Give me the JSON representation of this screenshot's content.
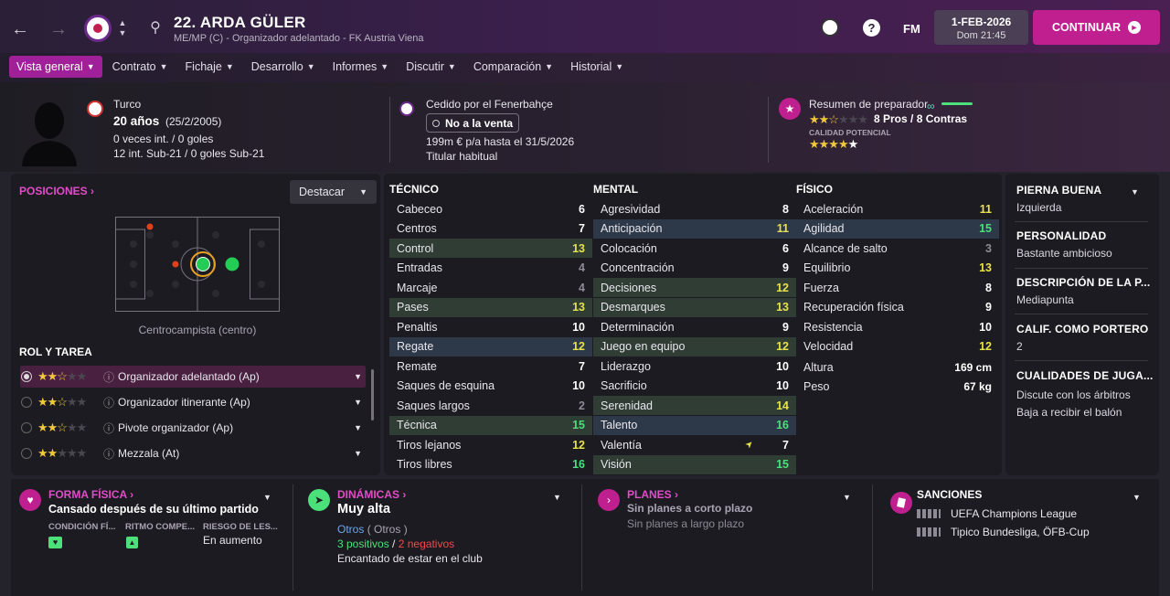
{
  "header": {
    "player_title": "22. ARDA GÜLER",
    "player_subtitle": "ME/MP (C) - Organizador adelantado - FK Austria Viena",
    "date": "1-FEB-2026",
    "day_time": "Dom 21:45",
    "continue_label": "CONTINUAR",
    "fm_label": "FM"
  },
  "nav": {
    "tabs": [
      {
        "label": "Vista general"
      },
      {
        "label": "Contrato"
      },
      {
        "label": "Fichaje"
      },
      {
        "label": "Desarrollo"
      },
      {
        "label": "Informes"
      },
      {
        "label": "Discutir"
      },
      {
        "label": "Comparación"
      },
      {
        "label": "Historial"
      }
    ]
  },
  "profile": {
    "nationality": "Turco",
    "age": "20 años",
    "birth": "(25/2/2005)",
    "caps": "0 veces int. / 0 goles",
    "u21": "12 int. Sub-21 / 0 goles Sub-21",
    "loan": "Cedido por el Fenerbahçe",
    "transfer_status": "No a la venta",
    "wage": "199m € p/a hasta el 31/5/2026",
    "squad_status": "Titular habitual",
    "coach_summary": "Resumen de preparador",
    "pros_cons": "8 Pros / 8 Contras",
    "potential_label": "CALIDAD POTENCIAL",
    "current_stars": "2.5",
    "potential_stars": "4.5"
  },
  "positions": {
    "title": "POSICIONES",
    "highlight": "Destacar",
    "position_name": "Centrocampista (centro)",
    "role_title": "ROL Y TAREA",
    "roles": [
      {
        "name": "Organizador adelantado (Ap)",
        "stars": "2.5"
      },
      {
        "name": "Organizador itinerante (Ap)",
        "stars": "2.5"
      },
      {
        "name": "Pivote organizador (Ap)",
        "stars": "2.5"
      },
      {
        "name": "Mezzala (At)",
        "stars": "2"
      }
    ]
  },
  "attributes": {
    "tecnico_title": "TÉCNICO",
    "mental_title": "MENTAL",
    "fisico_title": "FÍSICO",
    "tecnico": [
      {
        "name": "Cabeceo",
        "value": "6"
      },
      {
        "name": "Centros",
        "value": "7"
      },
      {
        "name": "Control",
        "value": "13"
      },
      {
        "name": "Entradas",
        "value": "4"
      },
      {
        "name": "Marcaje",
        "value": "4"
      },
      {
        "name": "Pases",
        "value": "13"
      },
      {
        "name": "Penaltis",
        "value": "10"
      },
      {
        "name": "Regate",
        "value": "12"
      },
      {
        "name": "Remate",
        "value": "7"
      },
      {
        "name": "Saques de esquina",
        "value": "10"
      },
      {
        "name": "Saques largos",
        "value": "2"
      },
      {
        "name": "Técnica",
        "value": "15"
      },
      {
        "name": "Tiros lejanos",
        "value": "12"
      },
      {
        "name": "Tiros libres",
        "value": "16"
      }
    ],
    "mental": [
      {
        "name": "Agresividad",
        "value": "8"
      },
      {
        "name": "Anticipación",
        "value": "11"
      },
      {
        "name": "Colocación",
        "value": "6"
      },
      {
        "name": "Concentración",
        "value": "9"
      },
      {
        "name": "Decisiones",
        "value": "12"
      },
      {
        "name": "Desmarques",
        "value": "13"
      },
      {
        "name": "Determinación",
        "value": "9"
      },
      {
        "name": "Juego en equipo",
        "value": "12"
      },
      {
        "name": "Liderazgo",
        "value": "10"
      },
      {
        "name": "Sacrificio",
        "value": "10"
      },
      {
        "name": "Serenidad",
        "value": "14"
      },
      {
        "name": "Talento",
        "value": "16"
      },
      {
        "name": "Valentía",
        "value": "7"
      },
      {
        "name": "Visión",
        "value": "15"
      }
    ],
    "fisico": [
      {
        "name": "Aceleración",
        "value": "11"
      },
      {
        "name": "Agilidad",
        "value": "15"
      },
      {
        "name": "Alcance de salto",
        "value": "3"
      },
      {
        "name": "Equilibrio",
        "value": "13"
      },
      {
        "name": "Fuerza",
        "value": "8"
      },
      {
        "name": "Recuperación física",
        "value": "9"
      },
      {
        "name": "Resistencia",
        "value": "10"
      },
      {
        "name": "Velocidad",
        "value": "12"
      }
    ],
    "altura_label": "Altura",
    "altura": "169 cm",
    "peso_label": "Peso",
    "peso": "67 kg"
  },
  "info": {
    "foot_h": "PIERNA BUENA",
    "foot_v": "Izquierda",
    "pers_h": "PERSONALIDAD",
    "pers_v": "Bastante ambicioso",
    "desc_h": "DESCRIPCIÓN DE LA P...",
    "desc_v": "Mediapunta",
    "gk_h": "CALIF. COMO PORTERO",
    "gk_v": "2",
    "qual_h": "CUALIDADES DE JUGA...",
    "qual_v1": "Discute con los árbitros",
    "qual_v2": "Baja a recibir el balón"
  },
  "bottom": {
    "forma_title": "FORMA FÍSICA",
    "forma_text": "Cansado después de su último partido",
    "cond_label": "CONDICIÓN FÍ...",
    "ritmo_label": "RITMO COMPE...",
    "riesgo_label": "RIESGO DE LES...",
    "riesgo_val": "En aumento",
    "din_title": "DINÁMICAS",
    "din_value": "Muy alta",
    "din_group": "Otros",
    "din_group_paren": "( Otros )",
    "din_pos": "3 positivos",
    "din_sep": "/",
    "din_neg": "2 negativos",
    "din_text": "Encantado de estar en el club",
    "planes_title": "PLANES",
    "planes_short": "Sin planes a corto plazo",
    "planes_long": "Sin planes a largo plazo",
    "sanc_title": "SANCIONES",
    "sanc_1": "UEFA Champions League",
    "sanc_2": "Tipico Bundesliga, ÖFB-Cup"
  },
  "colors": {
    "accent": "#c0208f",
    "good": "#4be07a",
    "mid": "#e8e24a"
  }
}
